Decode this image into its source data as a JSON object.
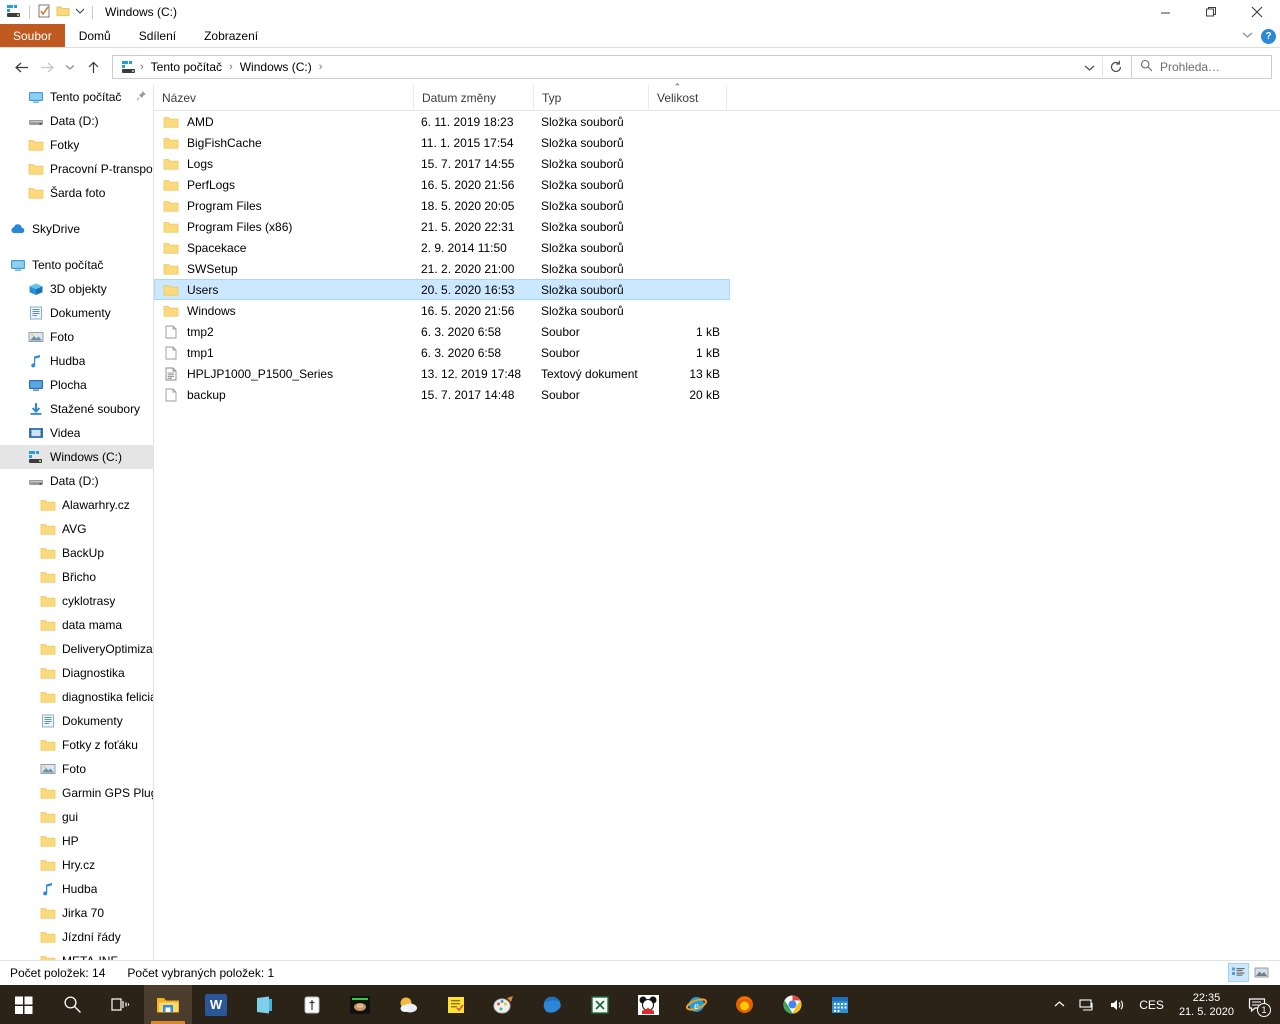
{
  "window": {
    "title": "Windows (C:)",
    "quick_access": [
      "drive-icon",
      "properties-icon",
      "new-folder-icon",
      "customize-dropdown-icon"
    ],
    "controls": {
      "minimize": "minimize-icon",
      "maximize": "maximize-icon",
      "close": "close-icon"
    }
  },
  "ribbon": {
    "tabs": [
      {
        "label": "Soubor",
        "active_file_tab": true
      },
      {
        "label": "Domů",
        "active_file_tab": false
      },
      {
        "label": "Sdílení",
        "active_file_tab": false
      },
      {
        "label": "Zobrazení",
        "active_file_tab": false
      }
    ],
    "expand_icon": "chevron-down-icon",
    "help_label": "?",
    "file_tab_color": "#bf5a21"
  },
  "navbar": {
    "back": "back-arrow-icon",
    "forward": "forward-arrow-icon",
    "recent": "chevron-down-icon",
    "up": "up-arrow-icon",
    "breadcrumb": {
      "root_icon": "drive-icon",
      "items": [
        "Tento počítač",
        "Windows (C:)"
      ],
      "separator": "›"
    },
    "dropdown": "chevron-down-icon",
    "refresh": "refresh-icon",
    "search_placeholder": "Prohleda…",
    "search_value": ""
  },
  "sidebar": {
    "items": [
      {
        "label": "Tento počítač",
        "icon": "monitor-icon",
        "indent": 1,
        "selected": false,
        "pinned": true
      },
      {
        "label": "Data (D:)",
        "icon": "drive-gray-icon",
        "indent": 1,
        "selected": false
      },
      {
        "label": "Fotky",
        "icon": "folder-icon",
        "indent": 1,
        "selected": false
      },
      {
        "label": "Pracovní P-transpo",
        "icon": "folder-icon",
        "indent": 1,
        "selected": false
      },
      {
        "label": "Šarda foto",
        "icon": "folder-icon",
        "indent": 1,
        "selected": false
      },
      {
        "gap": true
      },
      {
        "label": "SkyDrive",
        "icon": "cloud-icon",
        "indent": 0,
        "selected": false
      },
      {
        "gap": true
      },
      {
        "label": "Tento počítač",
        "icon": "monitor-icon",
        "indent": 0,
        "selected": false
      },
      {
        "label": "3D objekty",
        "icon": "cube-icon",
        "indent": 1,
        "selected": false
      },
      {
        "label": "Dokumenty",
        "icon": "document-icon",
        "indent": 1,
        "selected": false
      },
      {
        "label": "Foto",
        "icon": "picture-icon",
        "indent": 1,
        "selected": false
      },
      {
        "label": "Hudba",
        "icon": "music-note-icon",
        "indent": 1,
        "selected": false
      },
      {
        "label": "Plocha",
        "icon": "desktop-icon",
        "indent": 1,
        "selected": false
      },
      {
        "label": "Stažené soubory",
        "icon": "download-icon",
        "indent": 1,
        "selected": false
      },
      {
        "label": "Videa",
        "icon": "video-icon",
        "indent": 1,
        "selected": false
      },
      {
        "label": "Windows (C:)",
        "icon": "drive-icon",
        "indent": 1,
        "selected": true
      },
      {
        "label": "Data (D:)",
        "icon": "drive-gray-icon",
        "indent": 1,
        "selected": false
      },
      {
        "label": "Alawarhry.cz",
        "icon": "folder-icon",
        "indent": 2,
        "selected": false
      },
      {
        "label": "AVG",
        "icon": "folder-icon",
        "indent": 2,
        "selected": false
      },
      {
        "label": "BackUp",
        "icon": "folder-icon",
        "indent": 2,
        "selected": false
      },
      {
        "label": "Břicho",
        "icon": "folder-icon",
        "indent": 2,
        "selected": false
      },
      {
        "label": "cyklotrasy",
        "icon": "folder-icon",
        "indent": 2,
        "selected": false
      },
      {
        "label": "data mama",
        "icon": "folder-icon",
        "indent": 2,
        "selected": false
      },
      {
        "label": "DeliveryOptimizat",
        "icon": "folder-icon",
        "indent": 2,
        "selected": false
      },
      {
        "label": "Diagnostika",
        "icon": "folder-icon",
        "indent": 2,
        "selected": false
      },
      {
        "label": "diagnostika felicia",
        "icon": "folder-icon",
        "indent": 2,
        "selected": false
      },
      {
        "label": "Dokumenty",
        "icon": "document-icon",
        "indent": 2,
        "selected": false
      },
      {
        "label": "Fotky z foťáku",
        "icon": "folder-icon",
        "indent": 2,
        "selected": false
      },
      {
        "label": "Foto",
        "icon": "picture-icon",
        "indent": 2,
        "selected": false
      },
      {
        "label": "Garmin GPS Plugi",
        "icon": "folder-icon",
        "indent": 2,
        "selected": false
      },
      {
        "label": "gui",
        "icon": "folder-icon",
        "indent": 2,
        "selected": false
      },
      {
        "label": "HP",
        "icon": "folder-icon",
        "indent": 2,
        "selected": false
      },
      {
        "label": "Hry.cz",
        "icon": "folder-icon",
        "indent": 2,
        "selected": false
      },
      {
        "label": "Hudba",
        "icon": "music-note-icon",
        "indent": 2,
        "selected": false
      },
      {
        "label": "Jirka 70",
        "icon": "folder-icon",
        "indent": 2,
        "selected": false
      },
      {
        "label": "Jízdní řády",
        "icon": "folder-icon",
        "indent": 2,
        "selected": false
      },
      {
        "label": "META-INF",
        "icon": "folder-icon",
        "indent": 2,
        "selected": false
      }
    ]
  },
  "filelist": {
    "columns": [
      {
        "label": "Název",
        "sorted": false
      },
      {
        "label": "Datum změny",
        "sorted": false
      },
      {
        "label": "Typ",
        "sorted": false
      },
      {
        "label": "Velikost",
        "sorted": true,
        "sort_caret": "⌃"
      }
    ],
    "rows": [
      {
        "name": "AMD",
        "date": "6. 11. 2019 18:23",
        "type": "Složka souborů",
        "size": "",
        "icon": "folder-icon",
        "selected": false
      },
      {
        "name": "BigFishCache",
        "date": "11. 1. 2015 17:54",
        "type": "Složka souborů",
        "size": "",
        "icon": "folder-icon",
        "selected": false
      },
      {
        "name": "Logs",
        "date": "15. 7. 2017 14:55",
        "type": "Složka souborů",
        "size": "",
        "icon": "folder-icon",
        "selected": false
      },
      {
        "name": "PerfLogs",
        "date": "16. 5. 2020 21:56",
        "type": "Složka souborů",
        "size": "",
        "icon": "folder-icon",
        "selected": false
      },
      {
        "name": "Program Files",
        "date": "18. 5. 2020 20:05",
        "type": "Složka souborů",
        "size": "",
        "icon": "folder-icon",
        "selected": false
      },
      {
        "name": "Program Files (x86)",
        "date": "21. 5. 2020 22:31",
        "type": "Složka souborů",
        "size": "",
        "icon": "folder-icon",
        "selected": false
      },
      {
        "name": "Spacekace",
        "date": "2. 9. 2014 11:50",
        "type": "Složka souborů",
        "size": "",
        "icon": "folder-icon",
        "selected": false
      },
      {
        "name": "SWSetup",
        "date": "21. 2. 2020 21:00",
        "type": "Složka souborů",
        "size": "",
        "icon": "folder-icon",
        "selected": false
      },
      {
        "name": "Users",
        "date": "20. 5. 2020 16:53",
        "type": "Složka souborů",
        "size": "",
        "icon": "folder-icon",
        "selected": true
      },
      {
        "name": "Windows",
        "date": "16. 5. 2020 21:56",
        "type": "Složka souborů",
        "size": "",
        "icon": "folder-icon",
        "selected": false
      },
      {
        "name": "tmp2",
        "date": "6. 3. 2020 6:58",
        "type": "Soubor",
        "size": "1 kB",
        "icon": "file-icon",
        "selected": false
      },
      {
        "name": "tmp1",
        "date": "6. 3. 2020 6:58",
        "type": "Soubor",
        "size": "1 kB",
        "icon": "file-icon",
        "selected": false
      },
      {
        "name": "HPLJP1000_P1500_Series",
        "date": "13. 12. 2019 17:48",
        "type": "Textový dokument",
        "size": "13 kB",
        "icon": "text-file-icon",
        "selected": false
      },
      {
        "name": "backup",
        "date": "15. 7. 2017 14:48",
        "type": "Soubor",
        "size": "20 kB",
        "icon": "file-icon",
        "selected": false
      }
    ],
    "selection_color": "#cce8ff"
  },
  "statusbar": {
    "item_count": "Počet položek: 14",
    "selected_count": "Počet vybraných položek: 1",
    "view_details": "details-view-icon",
    "view_large_icons": "large-icons-view-icon"
  },
  "taskbar": {
    "start": "windows-start-icon",
    "search": "search-icon",
    "taskview": "task-view-icon",
    "apps": [
      {
        "name": "file-explorer-icon",
        "active": true
      },
      {
        "name": "word-icon",
        "active": false
      },
      {
        "name": "onenote-icon",
        "active": false
      },
      {
        "name": "whatsapp-icon",
        "active": false
      },
      {
        "name": "game-icon",
        "active": false
      },
      {
        "name": "weather-icon",
        "active": false
      },
      {
        "name": "notes-icon",
        "active": false
      },
      {
        "name": "paint-icon",
        "active": false
      },
      {
        "name": "edge-icon",
        "active": false
      },
      {
        "name": "excel-icon",
        "active": false
      },
      {
        "name": "mickey-icon",
        "active": false
      },
      {
        "name": "internet-explorer-icon",
        "active": false
      },
      {
        "name": "firefox-icon",
        "active": false
      },
      {
        "name": "chrome-icon",
        "active": false
      },
      {
        "name": "calendar-icon",
        "active": false
      }
    ],
    "tray": {
      "show_hidden": "chevron-up-icon",
      "network": "network-icon",
      "volume": "volume-icon",
      "language": "CES",
      "time": "22:35",
      "date": "21. 5. 2020",
      "notifications": "notification-icon",
      "notification_count": "1"
    }
  }
}
